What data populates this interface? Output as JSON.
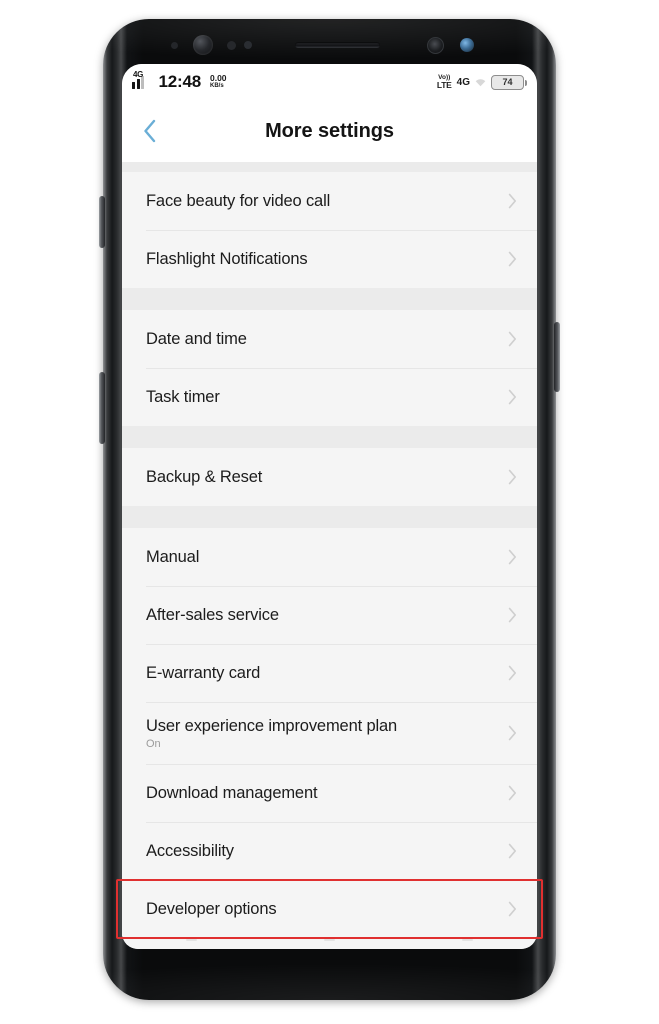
{
  "status_bar": {
    "network_type": "4G",
    "clock": "12:48",
    "data_rate_value": "0.00",
    "data_rate_unit": "KB/s",
    "volte_top": "Vo))",
    "volte_bottom": "LTE",
    "data_network": "4G",
    "battery_level": "74",
    "icons": {
      "signal": "signal-bars-icon",
      "wifi": "wifi-icon",
      "battery": "battery-icon",
      "volte": "volte-icon"
    }
  },
  "header": {
    "title": "More settings",
    "back_icon": "back-chevron-icon"
  },
  "list": {
    "chevron_icon": "chevron-right-icon",
    "groups": [
      {
        "id": "group-video-call",
        "items": [
          {
            "label": "Face beauty for video call",
            "subtitle": "",
            "highlighted": false
          },
          {
            "label": "Flashlight Notifications",
            "subtitle": "",
            "highlighted": false
          }
        ]
      },
      {
        "id": "group-time",
        "items": [
          {
            "label": "Date and time",
            "subtitle": "",
            "highlighted": false
          },
          {
            "label": "Task timer",
            "subtitle": "",
            "highlighted": false
          }
        ]
      },
      {
        "id": "group-backup",
        "items": [
          {
            "label": "Backup & Reset",
            "subtitle": "",
            "highlighted": false
          }
        ]
      },
      {
        "id": "group-support",
        "items": [
          {
            "label": "Manual",
            "subtitle": "",
            "highlighted": false
          },
          {
            "label": "After-sales service",
            "subtitle": "",
            "highlighted": false
          },
          {
            "label": "E-warranty card",
            "subtitle": "",
            "highlighted": false
          },
          {
            "label": "User experience improvement plan",
            "subtitle": "On",
            "highlighted": false
          },
          {
            "label": "Download management",
            "subtitle": "",
            "highlighted": false
          },
          {
            "label": "Accessibility",
            "subtitle": "",
            "highlighted": false
          },
          {
            "label": "Developer options",
            "subtitle": "",
            "highlighted": true
          }
        ]
      }
    ]
  },
  "annotation": {
    "highlight_color": "#e03030",
    "highlight_target": "Developer options"
  },
  "device": {
    "accent_back_arrow_color": "#6aaed6",
    "screen_background": "#f5f5f5",
    "header_background": "#ffffff"
  }
}
